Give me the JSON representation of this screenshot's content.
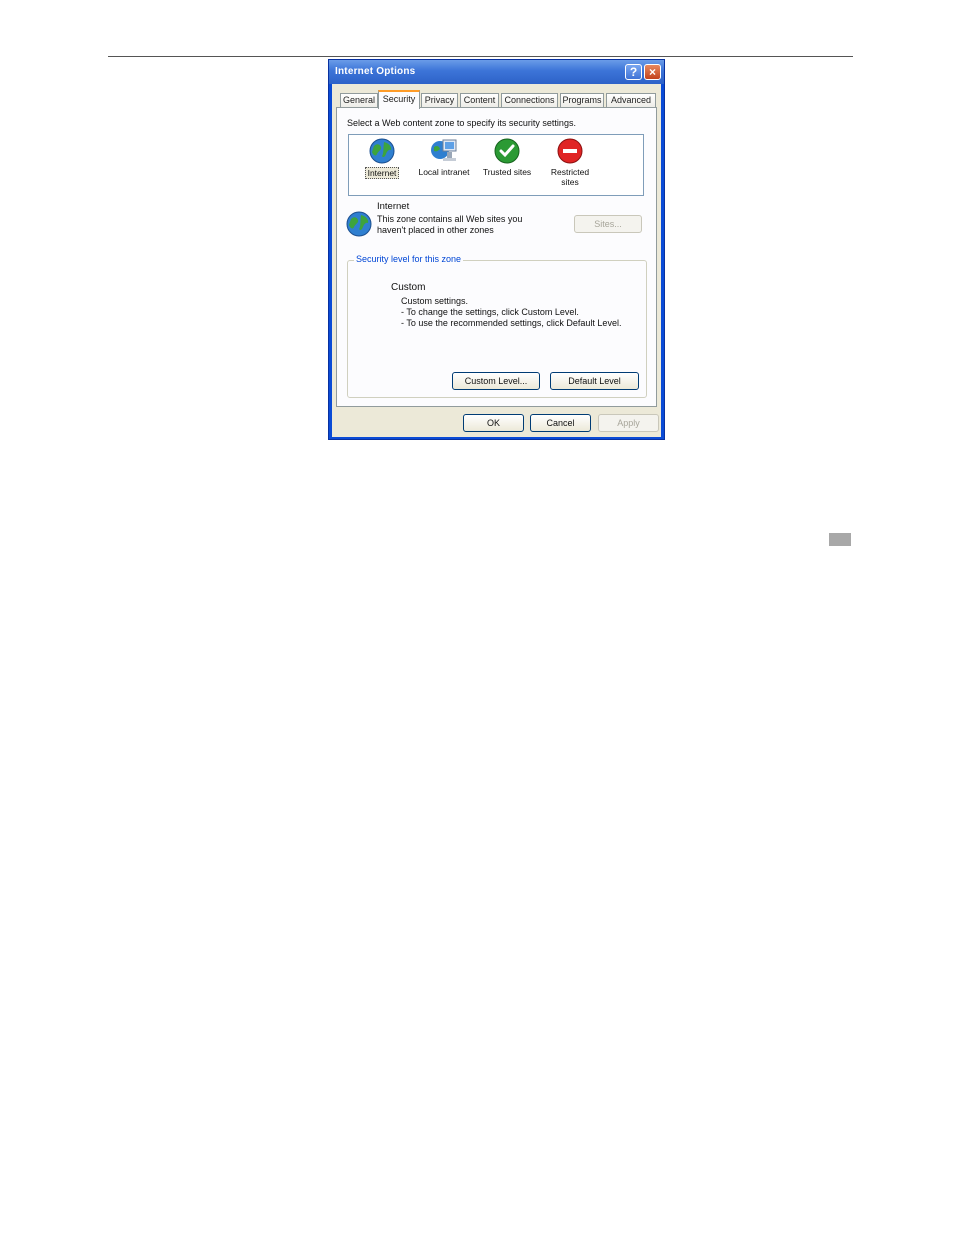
{
  "dialog": {
    "title": "Internet Options",
    "help_glyph": "?",
    "close_glyph": "×"
  },
  "tabs": [
    {
      "label": "General"
    },
    {
      "label": "Security"
    },
    {
      "label": "Privacy"
    },
    {
      "label": "Content"
    },
    {
      "label": "Connections"
    },
    {
      "label": "Programs"
    },
    {
      "label": "Advanced"
    }
  ],
  "active_tab": "Security",
  "security": {
    "prompt": "Select a Web content zone to specify its security settings.",
    "zones": [
      {
        "label": "Internet",
        "icon": "globe-icon",
        "selected": true
      },
      {
        "label": "Local intranet",
        "icon": "intranet-icon",
        "selected": false
      },
      {
        "label": "Trusted sites",
        "icon": "checkmark-icon",
        "selected": false
      },
      {
        "label": "Restricted sites",
        "icon": "no-entry-icon",
        "selected": false
      }
    ],
    "selected_zone": {
      "name": "Internet",
      "description": "This zone contains all Web sites you haven't placed in other zones",
      "sites_button": "Sites...",
      "sites_enabled": false
    },
    "level_group": {
      "legend": "Security level for this zone",
      "level_name": "Custom",
      "lines": [
        "Custom settings.",
        "- To change the settings, click Custom Level.",
        "- To use the recommended settings, click Default Level."
      ],
      "custom_level_button": "Custom Level...",
      "default_level_button": "Default Level"
    }
  },
  "footer": {
    "ok": "OK",
    "cancel": "Cancel",
    "apply": "Apply",
    "apply_enabled": false
  },
  "colors": {
    "titlebar": "#3c74d8",
    "dialog_face": "#ece9d8",
    "active_tab_accent": "#ff9c28",
    "group_legend": "#0046d5"
  }
}
